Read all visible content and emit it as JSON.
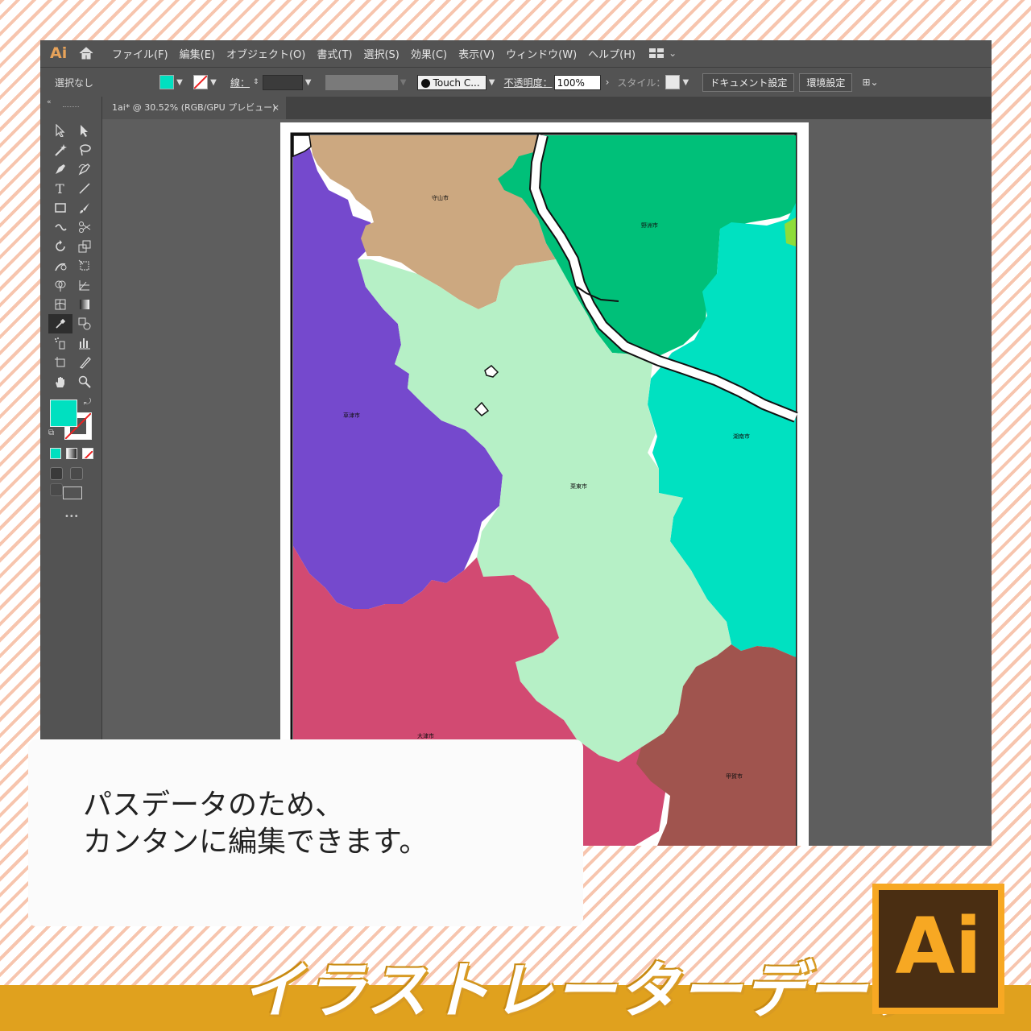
{
  "menubar": {
    "app_mark": "Ai",
    "items": [
      "ファイル(F)",
      "編集(E)",
      "オブジェクト(O)",
      "書式(T)",
      "選択(S)",
      "効果(C)",
      "表示(V)",
      "ウィンドウ(W)",
      "ヘルプ(H)"
    ]
  },
  "control_bar": {
    "selection": "選択なし",
    "fill_color": "#00e0c0",
    "stroke_label": "線：",
    "brush": "Touch C...",
    "opacity_label": "不透明度：",
    "opacity_value": "100%",
    "style_label": "スタイル：",
    "doc_setup": "ドキュメント設定",
    "prefs": "環境設定"
  },
  "document_tab": {
    "title": "1ai* @ 30.52% (RGB/GPU プレビュー)",
    "close": "×"
  },
  "toolbar": {
    "fill": "#00e0c0",
    "more": "•••",
    "tools": [
      "selection-tool",
      "direct-selection-tool",
      "magic-wand-tool",
      "lasso-tool",
      "pen-tool",
      "curvature-tool",
      "type-tool",
      "line-tool",
      "rectangle-tool",
      "paintbrush-tool",
      "shaper-tool",
      "scissors-tool",
      "rotate-tool",
      "scale-tool",
      "warp-tool",
      "free-transform-tool",
      "shape-builder-tool",
      "perspective-grid-tool",
      "mesh-tool",
      "gradient-tool",
      "eyedropper-tool",
      "blend-tool",
      "symbol-sprayer-tool",
      "graph-tool",
      "artboard-tool",
      "slice-tool",
      "hand-tool",
      "zoom-tool"
    ]
  },
  "map": {
    "labels": {
      "moriyama": "守山市",
      "yasu": "野洲市",
      "kusatsu": "草津市",
      "konan": "湖南市",
      "ritto": "栗東市",
      "otsu": "大津市",
      "koka": "甲賀市"
    },
    "colors": {
      "moriyama": "#cca880",
      "yasu": "#00c079",
      "kusatsu": "#7549cd",
      "konan": "#00e1c1",
      "ritto": "#b6f0c6",
      "otsu": "#d24a72",
      "koka": "#a0544e"
    }
  },
  "caption": {
    "line1": "パスデータのため、",
    "line2": "カンタンに編集できます。"
  },
  "footer": {
    "title": "イラストレーターデータ",
    "logo": "Ai"
  }
}
